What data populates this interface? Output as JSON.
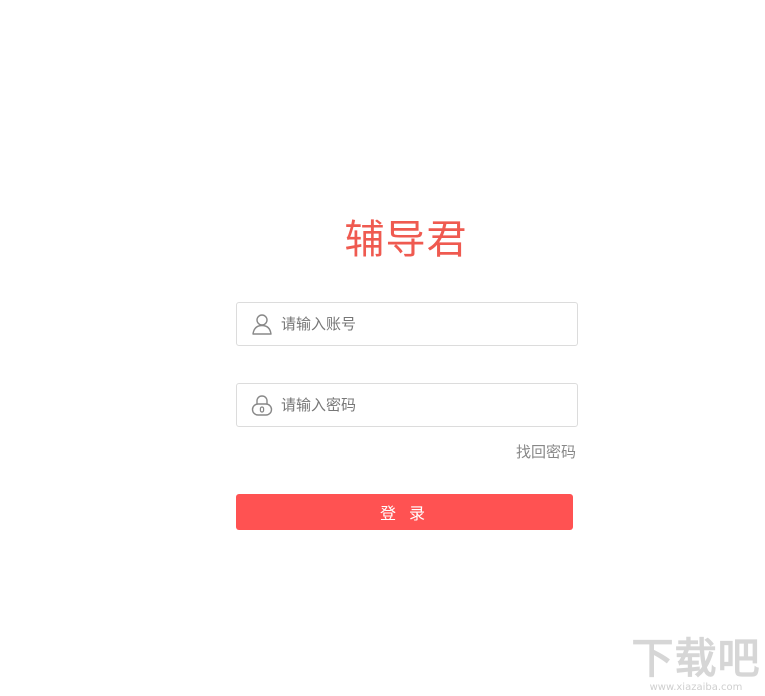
{
  "brand": {
    "logo_text": "辅导君",
    "accent_color": "#ef5a50"
  },
  "login_form": {
    "account_field": {
      "placeholder": "请输入账号",
      "value": "",
      "icon": "user-icon"
    },
    "password_field": {
      "placeholder": "请输入密码",
      "value": "",
      "icon": "lock-icon"
    },
    "forgot_password_label": "找回密码",
    "login_button_label": "登 录",
    "button_color": "#ff5252"
  },
  "watermark": {
    "title": "下载吧",
    "url": "www.xiazaiba.com"
  }
}
